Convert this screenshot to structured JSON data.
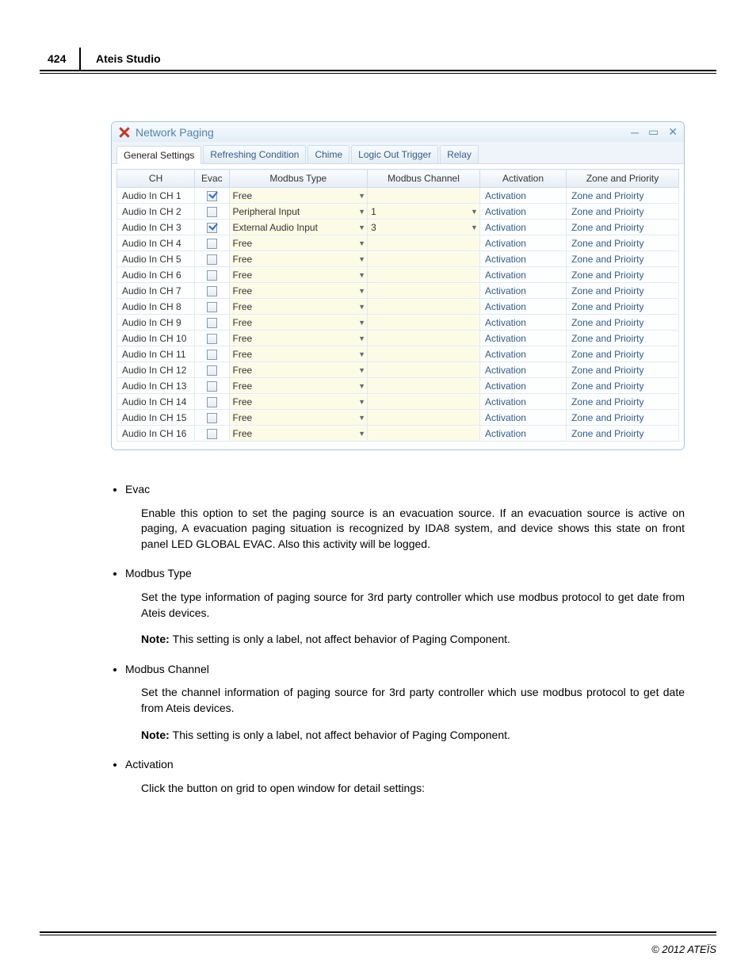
{
  "page": {
    "number": "424",
    "title": "Ateis Studio",
    "footer": "© 2012 ATEÏS"
  },
  "window": {
    "title": "Network Paging",
    "tabs": [
      "General Settings",
      "Refreshing Condition",
      "Chime",
      "Logic Out Trigger",
      "Relay"
    ],
    "active_tab": 0,
    "columns": [
      "CH",
      "Evac",
      "Modbus Type",
      "Modbus Channel",
      "Activation",
      "Zone and  Priority"
    ],
    "rows": [
      {
        "ch": "Audio In CH 1",
        "evac": true,
        "type": "Free",
        "chan": "",
        "act": "Activation",
        "zone": "Zone and Prioirty"
      },
      {
        "ch": "Audio In CH 2",
        "evac": false,
        "type": "Peripheral Input",
        "chan": "1",
        "act": "Activation",
        "zone": "Zone and Prioirty"
      },
      {
        "ch": "Audio In CH 3",
        "evac": true,
        "type": "External Audio Input",
        "chan": "3",
        "act": "Activation",
        "zone": "Zone and Prioirty"
      },
      {
        "ch": "Audio In CH 4",
        "evac": false,
        "type": "Free",
        "chan": "",
        "act": "Activation",
        "zone": "Zone and Prioirty"
      },
      {
        "ch": "Audio In CH 5",
        "evac": false,
        "type": "Free",
        "chan": "",
        "act": "Activation",
        "zone": "Zone and Prioirty"
      },
      {
        "ch": "Audio In CH 6",
        "evac": false,
        "type": "Free",
        "chan": "",
        "act": "Activation",
        "zone": "Zone and Prioirty"
      },
      {
        "ch": "Audio In CH 7",
        "evac": false,
        "type": "Free",
        "chan": "",
        "act": "Activation",
        "zone": "Zone and Prioirty"
      },
      {
        "ch": "Audio In CH 8",
        "evac": false,
        "type": "Free",
        "chan": "",
        "act": "Activation",
        "zone": "Zone and Prioirty"
      },
      {
        "ch": "Audio In CH 9",
        "evac": false,
        "type": "Free",
        "chan": "",
        "act": "Activation",
        "zone": "Zone and Prioirty"
      },
      {
        "ch": "Audio In CH 10",
        "evac": false,
        "type": "Free",
        "chan": "",
        "act": "Activation",
        "zone": "Zone and Prioirty"
      },
      {
        "ch": "Audio In CH 11",
        "evac": false,
        "type": "Free",
        "chan": "",
        "act": "Activation",
        "zone": "Zone and Prioirty"
      },
      {
        "ch": "Audio In CH 12",
        "evac": false,
        "type": "Free",
        "chan": "",
        "act": "Activation",
        "zone": "Zone and Prioirty"
      },
      {
        "ch": "Audio In CH 13",
        "evac": false,
        "type": "Free",
        "chan": "",
        "act": "Activation",
        "zone": "Zone and Prioirty"
      },
      {
        "ch": "Audio In CH 14",
        "evac": false,
        "type": "Free",
        "chan": "",
        "act": "Activation",
        "zone": "Zone and Prioirty"
      },
      {
        "ch": "Audio In CH 15",
        "evac": false,
        "type": "Free",
        "chan": "",
        "act": "Activation",
        "zone": "Zone and Prioirty"
      },
      {
        "ch": "Audio In CH 16",
        "evac": false,
        "type": "Free",
        "chan": "",
        "act": "Activation",
        "zone": "Zone and Prioirty"
      }
    ]
  },
  "doc": {
    "items": [
      {
        "title": "Evac",
        "body": "Enable this option to set the paging source is an evacuation source. If an evacuation source is active on paging, A evacuation paging situation is recognized by IDA8 system, and device shows this state on front panel LED GLOBAL EVAC. Also this activity will be logged."
      },
      {
        "title": "Modbus Type",
        "body": "Set the type information of paging source  for 3rd party controller which use modbus protocol to get date from Ateis devices.",
        "note": "This setting is only a label, not affect behavior of Paging Component."
      },
      {
        "title": "Modbus Channel",
        "body": "Set the channel information of paging source  for 3rd party controller which use modbus protocol to get date from Ateis devices.",
        "note": "This setting is only a label, not affect behavior of Paging Component."
      },
      {
        "title": "Activation",
        "body": "Click the button on grid to open window for detail settings:"
      }
    ],
    "note_label": "Note:"
  }
}
